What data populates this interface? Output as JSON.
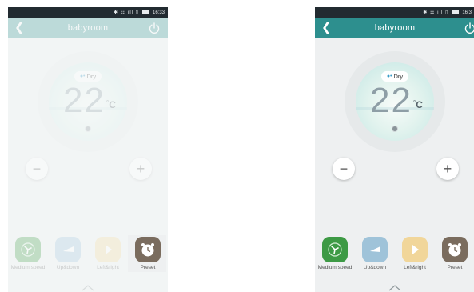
{
  "status": {
    "time_left": "16:33",
    "time_right": "16:3"
  },
  "title": "babyroom",
  "mode": {
    "label": "Dry"
  },
  "temperature": {
    "value": "22",
    "unit": "C"
  },
  "buttons": {
    "minus": "−",
    "plus": "+"
  },
  "functions": [
    {
      "label": "Medium speed"
    },
    {
      "label": "Up&down"
    },
    {
      "label": "Left&right"
    },
    {
      "label": "Preset"
    }
  ],
  "colors": {
    "titlebar": "#2d8f8e",
    "speed": "#3d9a45",
    "updown": "#9fc3d9",
    "leftright": "#f1d69a",
    "preset": "#7a6c5e"
  }
}
